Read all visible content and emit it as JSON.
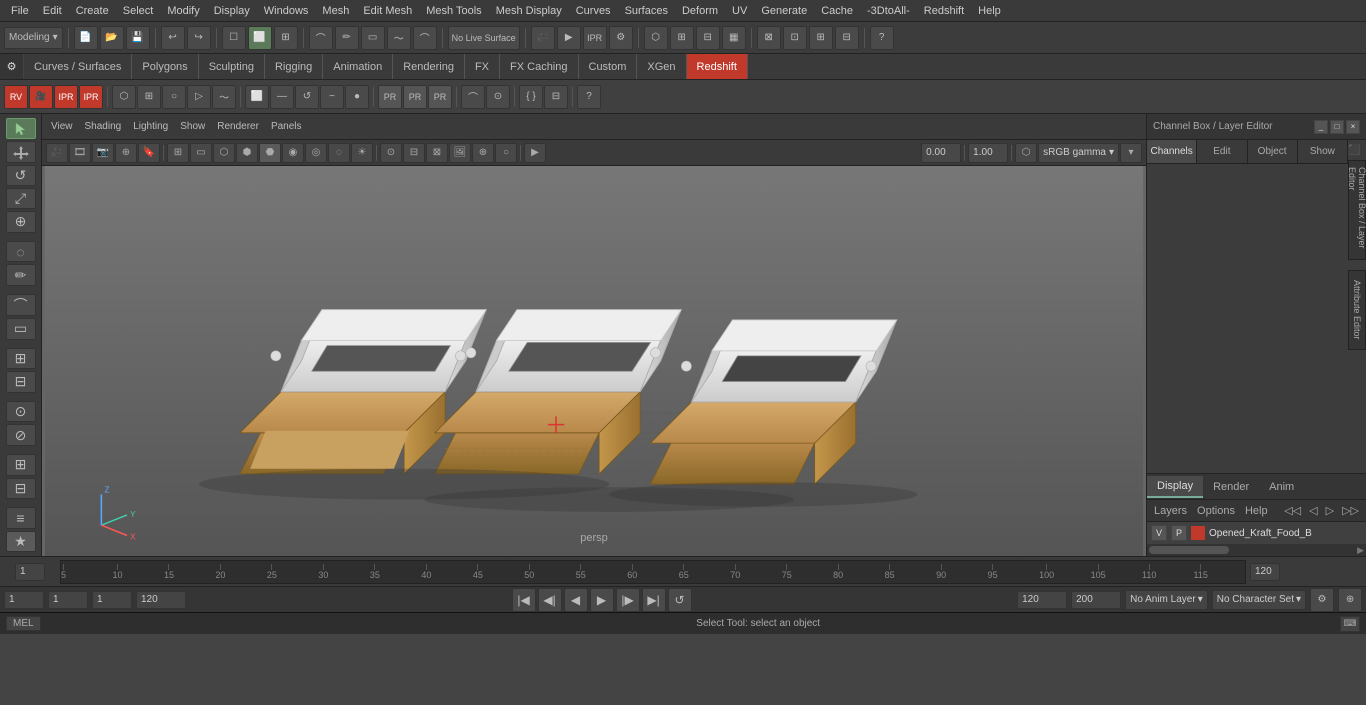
{
  "menubar": {
    "items": [
      "File",
      "Edit",
      "Create",
      "Select",
      "Modify",
      "Display",
      "Windows",
      "Mesh",
      "Edit Mesh",
      "Mesh Tools",
      "Mesh Display",
      "Curves",
      "Surfaces",
      "Deform",
      "UV",
      "Generate",
      "Cache",
      "-3DtoAll-",
      "Redshift",
      "Help"
    ]
  },
  "toolbar1": {
    "workspace_dropdown": "Modeling",
    "live_surface_label": "No Live Surface"
  },
  "tabs": {
    "items": [
      "Curves / Surfaces",
      "Polygons",
      "Sculpting",
      "Rigging",
      "Animation",
      "Rendering",
      "FX",
      "FX Caching",
      "Custom",
      "XGen",
      "Redshift"
    ],
    "active": "Redshift"
  },
  "viewport": {
    "label": "persp",
    "camera_value": "0.00",
    "zoom_value": "1.00",
    "color_space": "sRGB gamma"
  },
  "viewport_menus": [
    "View",
    "Shading",
    "Lighting",
    "Show",
    "Renderer",
    "Panels"
  ],
  "right_panel": {
    "title": "Channel Box / Layer Editor",
    "tabs": [
      "Channels",
      "Edit",
      "Object",
      "Show"
    ],
    "active_tab": "Channels"
  },
  "layer_section": {
    "tabs": [
      "Display",
      "Render",
      "Anim"
    ],
    "active_tab": "Display",
    "sub_menus": [
      "Layers",
      "Options",
      "Help"
    ],
    "layer_row": {
      "v": "V",
      "p": "P",
      "color": "#c0392b",
      "name": "Opened_Kraft_Food_B"
    }
  },
  "timeline": {
    "ticks": [
      5,
      10,
      15,
      20,
      25,
      30,
      35,
      40,
      45,
      50,
      55,
      60,
      65,
      70,
      75,
      80,
      85,
      90,
      95,
      100,
      105,
      110,
      115,
      120
    ],
    "current_frame": "1"
  },
  "status_bar": {
    "field1": "1",
    "field2": "1",
    "field3": "1",
    "field4": "120",
    "field5": "120",
    "field6": "200",
    "anim_layer": "No Anim Layer",
    "char_set": "No Character Set"
  },
  "command_bar": {
    "language": "MEL",
    "status_text": "Select Tool: select an object"
  },
  "icons": {
    "arrow": "↖",
    "move": "✛",
    "rotate": "↺",
    "scale": "⤢",
    "snap_grid": "⊞",
    "snap_curve": "⌒",
    "snap_point": "⊕",
    "camera": "📷",
    "grid": "⊟",
    "wireframe": "⬡",
    "smooth": "⬢",
    "texture": "▦",
    "render": "▶",
    "undo": "↩",
    "redo": "↪",
    "layers_icon": "≡",
    "help": "?",
    "x_axis": "X",
    "y_axis": "Y",
    "z_axis": "Z"
  }
}
